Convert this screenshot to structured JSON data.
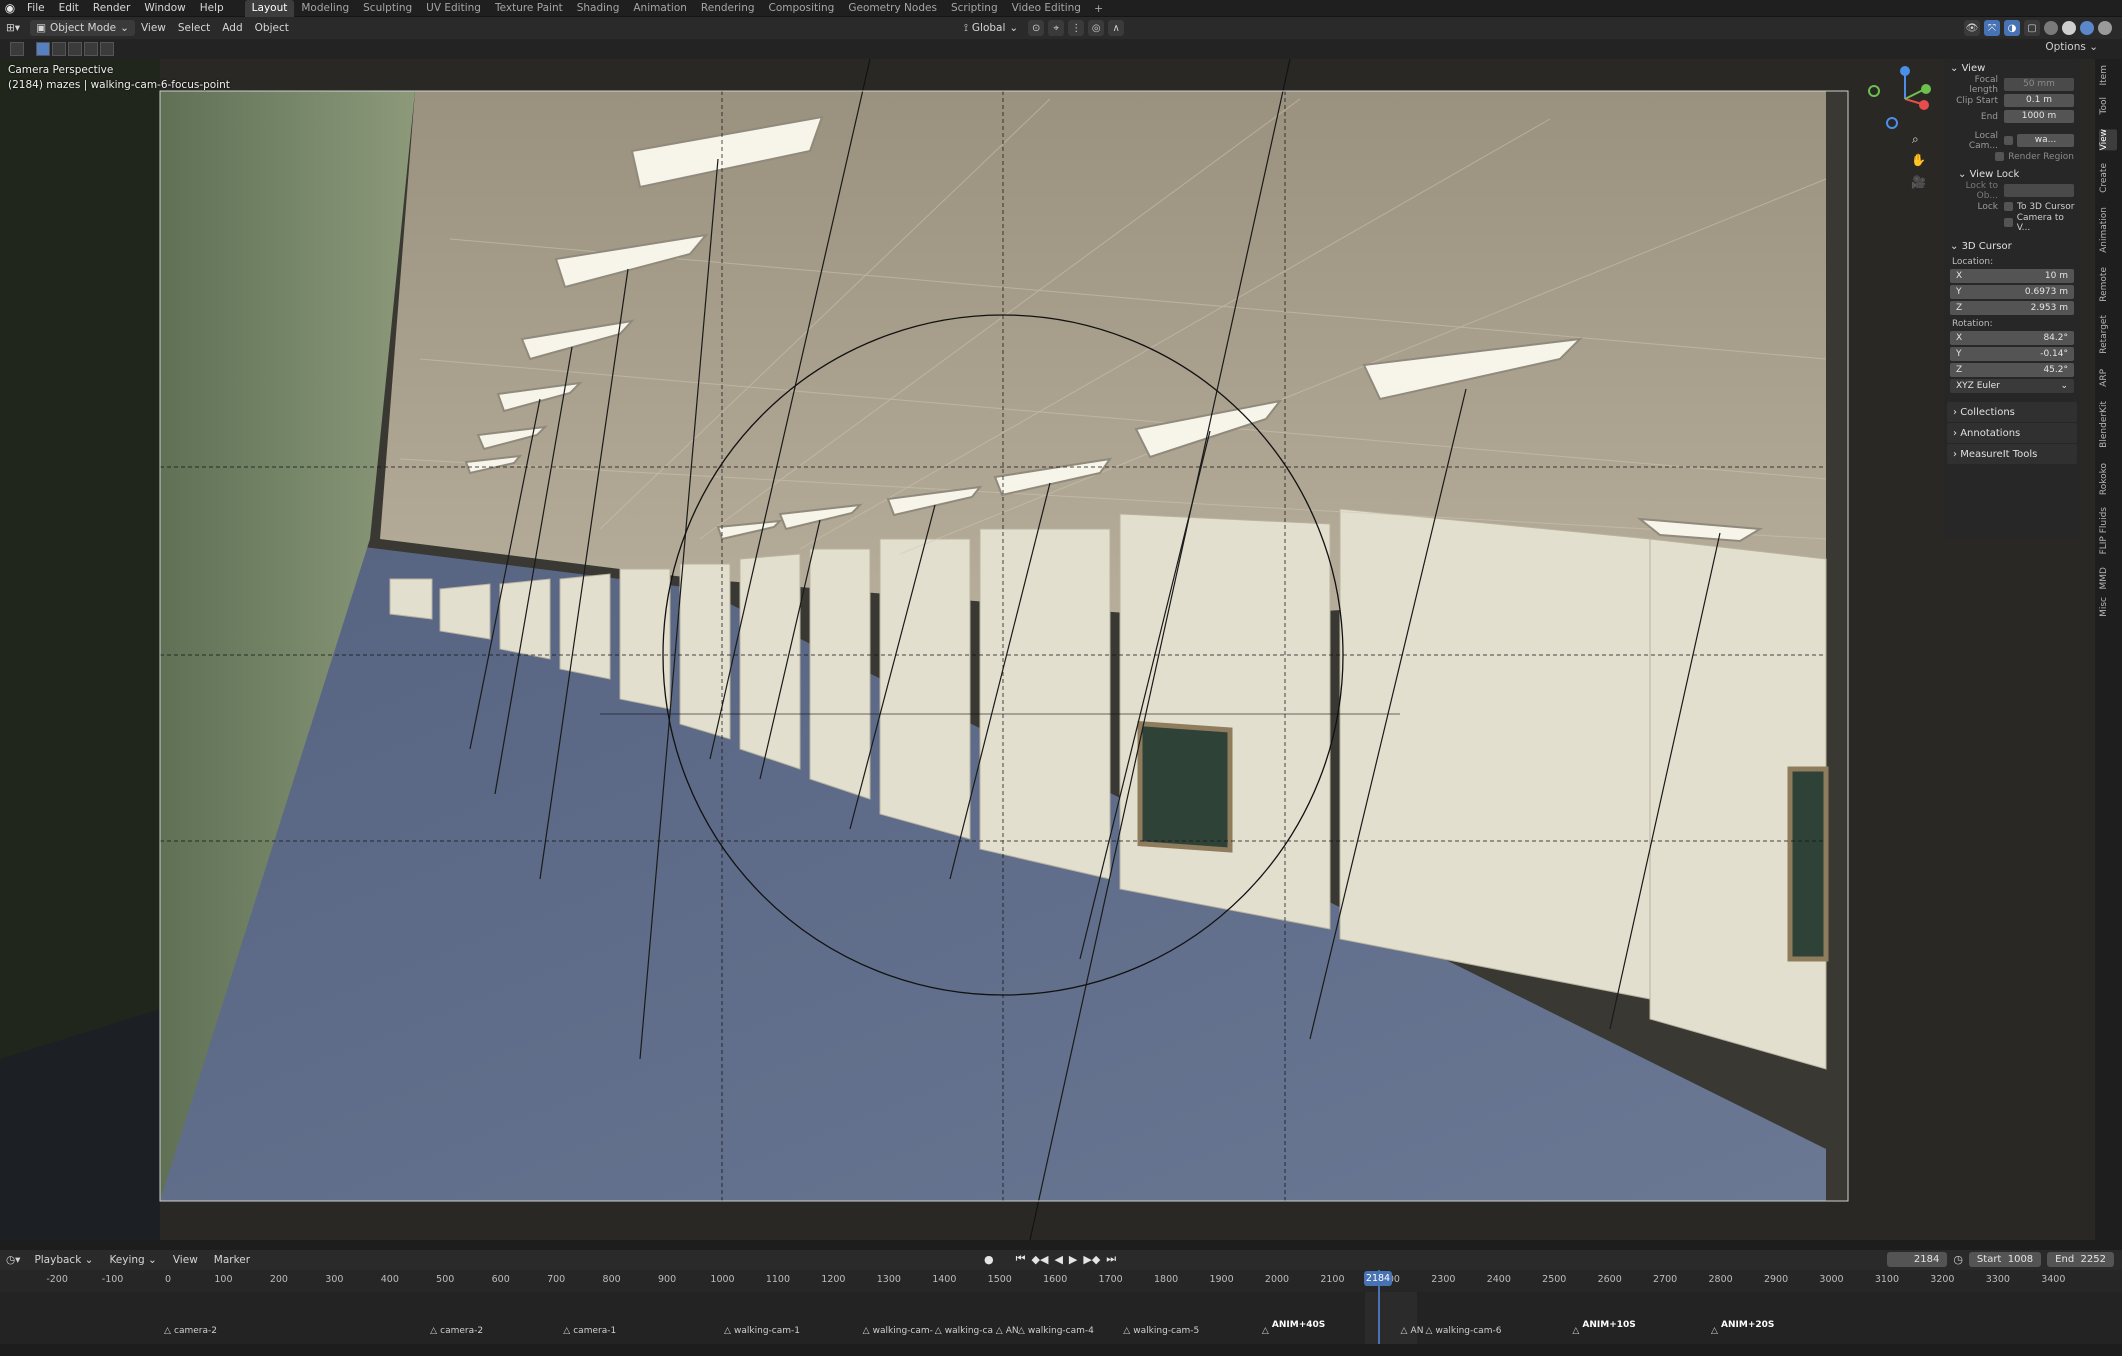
{
  "menubar": {
    "items": [
      "File",
      "Edit",
      "Render",
      "Window",
      "Help"
    ],
    "workspaces": [
      "Layout",
      "Modeling",
      "Sculpting",
      "UV Editing",
      "Texture Paint",
      "Shading",
      "Animation",
      "Rendering",
      "Compositing",
      "Geometry Nodes",
      "Scripting",
      "Video Editing"
    ],
    "active_workspace": "Layout",
    "add_label": "+"
  },
  "viewport_header": {
    "mode": "Object Mode",
    "menus": [
      "View",
      "Select",
      "Add",
      "Object"
    ],
    "transform_orientation": "Global",
    "options_label": "Options"
  },
  "viewport": {
    "camera_label": "Camera Perspective",
    "object_label": "(2184) mazes | walking-cam-6-focus-point"
  },
  "npanel": {
    "view_section": "View",
    "focal_length_label": "Focal length",
    "focal_length_value": "50 mm",
    "clip_start_label": "Clip Start",
    "clip_start_value": "0.1 m",
    "end_label": "End",
    "end_value": "1000 m",
    "local_camera_label": "Local Cam...",
    "local_camera_value": "wa...",
    "render_region_label": "Render Region",
    "view_lock_section": "View Lock",
    "lock_to_object_label": "Lock to Ob...",
    "lock_label": "Lock",
    "to_3d_cursor_label": "To 3D Cursor",
    "camera_to_view_label": "Camera to V...",
    "cursor_section": "3D Cursor",
    "location_label": "Location:",
    "loc_x": "10 m",
    "loc_y": "0.6973 m",
    "loc_z": "2.953 m",
    "rotation_label": "Rotation:",
    "rot_x": "84.2°",
    "rot_y": "-0.14°",
    "rot_z": "45.2°",
    "rotation_mode": "XYZ Euler",
    "collections": "Collections",
    "annotations": "Annotations",
    "measureit": "MeasureIt Tools"
  },
  "side_tabs": [
    "Item",
    "Tool",
    "View",
    "Create",
    "Animation",
    "Remote",
    "Retarget",
    "ARP",
    "BlenderKit",
    "Rokoko",
    "FLIP Fluids",
    "MMD",
    "Misc"
  ],
  "active_side_tab": "View",
  "timeline": {
    "menus": [
      "Playback",
      "Keying",
      "View",
      "Marker"
    ],
    "current_frame": "2184",
    "start_label": "Start",
    "start_value": "1008",
    "end_label": "End",
    "end_value": "2252",
    "ticks": [
      "-200",
      "-100",
      "0",
      "100",
      "200",
      "300",
      "400",
      "500",
      "600",
      "700",
      "800",
      "900",
      "1000",
      "1100",
      "1200",
      "1300",
      "1400",
      "1500",
      "1600",
      "1700",
      "1800",
      "1900",
      "2000",
      "2100",
      "2200",
      "2300",
      "2400",
      "2500",
      "2600",
      "2700",
      "2800",
      "2900",
      "3000",
      "3100",
      "3200",
      "3300",
      "3400"
    ],
    "playhead_label": "2184",
    "markers": [
      {
        "label": "camera-2",
        "frame": 0
      },
      {
        "label": "camera-2",
        "frame": 480
      },
      {
        "label": "camera-1",
        "frame": 720
      },
      {
        "label": "walking-cam-1",
        "frame": 1010
      },
      {
        "label": "walking-cam-",
        "frame": 1260
      },
      {
        "label": "walking-ca",
        "frame": 1390
      },
      {
        "label": "AN",
        "frame": 1500
      },
      {
        "label": "walking-cam-4",
        "frame": 1540
      },
      {
        "label": "walking-cam-5",
        "frame": 1730
      },
      {
        "label": "ANIM+40S",
        "frame": 1980
      },
      {
        "label": "AN",
        "frame": 2230
      },
      {
        "label": "walking-cam-6",
        "frame": 2275
      },
      {
        "label": "ANIM+10S",
        "frame": 2540
      },
      {
        "label": "ANIM+20S",
        "frame": 2790
      }
    ]
  },
  "colors": {
    "accent": "#4772b3",
    "header_bg": "#2a2a2a",
    "ceiling": "#a69c8a",
    "floor": "#5d6b86",
    "wall_green": "#7d8c6c",
    "partition": "#e3dfcf"
  }
}
